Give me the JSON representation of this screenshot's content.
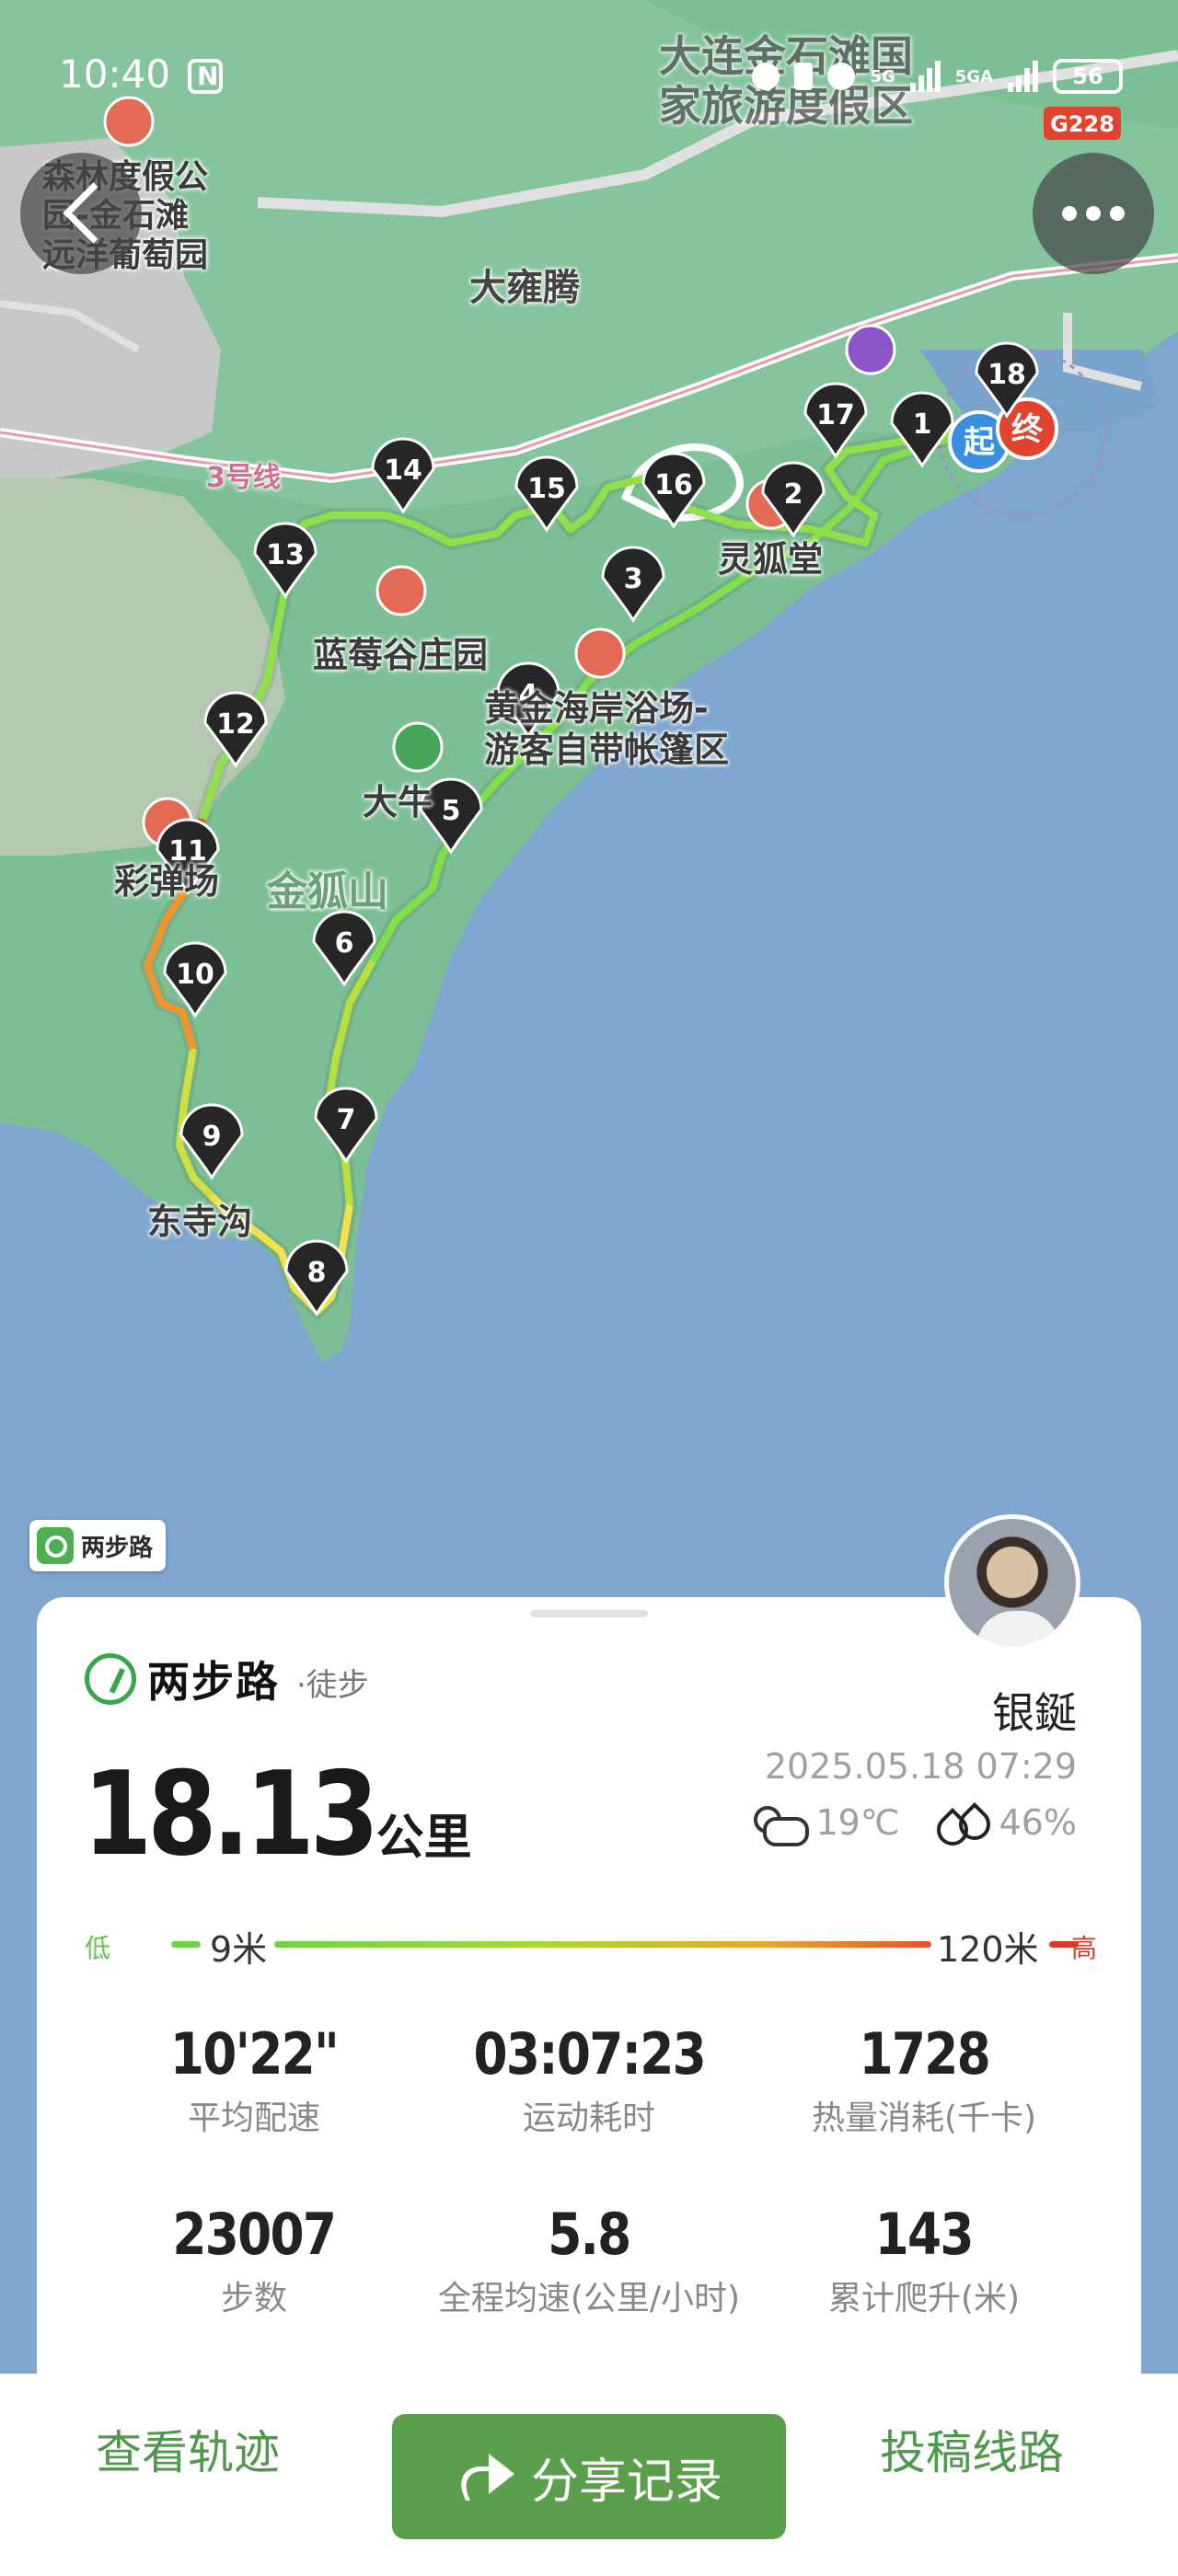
{
  "status": {
    "time": "10:40",
    "battery": "56",
    "net1": "5G",
    "net2": "5GA"
  },
  "map": {
    "labels": [
      "大连金石滩国",
      "家旅游度假区",
      "G228",
      "森林度假公",
      "园-金石滩",
      "远洋葡萄园",
      "大雍腾",
      "3号线",
      "灵狐堂",
      "蓝莓谷庄园",
      "黄金海岸浴场-",
      "游客自带帐篷区",
      "大牛",
      "金狐山",
      "彩弹场",
      "东寺沟"
    ],
    "start_label": "起",
    "end_label": "终",
    "markers": [
      "1",
      "2",
      "3",
      "4",
      "5",
      "6",
      "7",
      "8",
      "9",
      "10",
      "11",
      "12",
      "13",
      "14",
      "15",
      "16",
      "17",
      "18"
    ]
  },
  "watermark": {
    "text": "两步路"
  },
  "card": {
    "brand_name": "两步路",
    "activity_type": "·徒步",
    "username": "银鋋",
    "distance": "18.13",
    "distance_unit": "公里",
    "datetime": "2025.05.18 07:29",
    "temperature": "19℃",
    "humidity": "46%",
    "elevation": {
      "low_label": "低",
      "high_label": "高",
      "min": "9米",
      "max": "120米"
    },
    "stats": [
      {
        "value": "10'22\"",
        "label": "平均配速"
      },
      {
        "value": "03:07:23",
        "label": "运动耗时"
      },
      {
        "value": "1728",
        "label": "热量消耗(千卡)"
      },
      {
        "value": "23007",
        "label": "步数"
      },
      {
        "value": "5.8",
        "label": "全程均速(公里/小时)"
      },
      {
        "value": "143",
        "label": "累计爬升(米)"
      }
    ]
  },
  "bottom": {
    "view_track": "查看轨迹",
    "share": "分享记录",
    "submit_route": "投稿线路"
  }
}
